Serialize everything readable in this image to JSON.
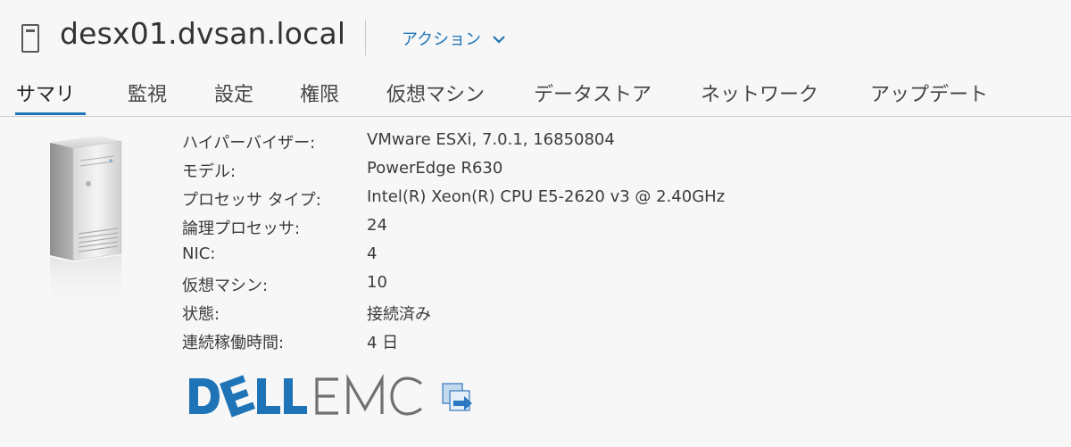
{
  "header": {
    "host_name": "desx01.dvsan.local",
    "actions_label": "アクション",
    "host_icon": "host-icon",
    "actions_icon": "chevron-down-icon"
  },
  "tabs": [
    {
      "label": "サマリ",
      "active": true
    },
    {
      "label": "監視",
      "active": false
    },
    {
      "label": "設定",
      "active": false
    },
    {
      "label": "権限",
      "active": false
    },
    {
      "label": "仮想マシン",
      "active": false
    },
    {
      "label": "データストア",
      "active": false
    },
    {
      "label": "ネットワーク",
      "active": false
    },
    {
      "label": "アップデート",
      "active": false
    }
  ],
  "summary": {
    "illustration_icon": "server-tower-icon",
    "properties": [
      {
        "label": "ハイパーバイザー:",
        "value": "VMware ESXi, 7.0.1, 16850804"
      },
      {
        "label": "モデル:",
        "value": "PowerEdge R630"
      },
      {
        "label": "プロセッサ タイプ:",
        "value": "Intel(R) Xeon(R) CPU E5-2620 v3 @ 2.40GHz"
      },
      {
        "label": "論理プロセッサ:",
        "value": "24"
      },
      {
        "label": "NIC:",
        "value": "4"
      },
      {
        "label": "仮想マシン:",
        "value": "10"
      },
      {
        "label": "状態:",
        "value": "接続済み"
      },
      {
        "label": "連続稼働時間:",
        "value": "4 日"
      }
    ]
  },
  "vendor": {
    "logo_icon": "dell-emc-logo",
    "logo_text": "DELLEMC",
    "link_icon": "vendor-management-link-icon"
  },
  "colors": {
    "accent": "#1f74b7",
    "dell_blue": "#1f74b7",
    "emc_gray": "#6e6e6e",
    "background": "#f7f7f7"
  }
}
